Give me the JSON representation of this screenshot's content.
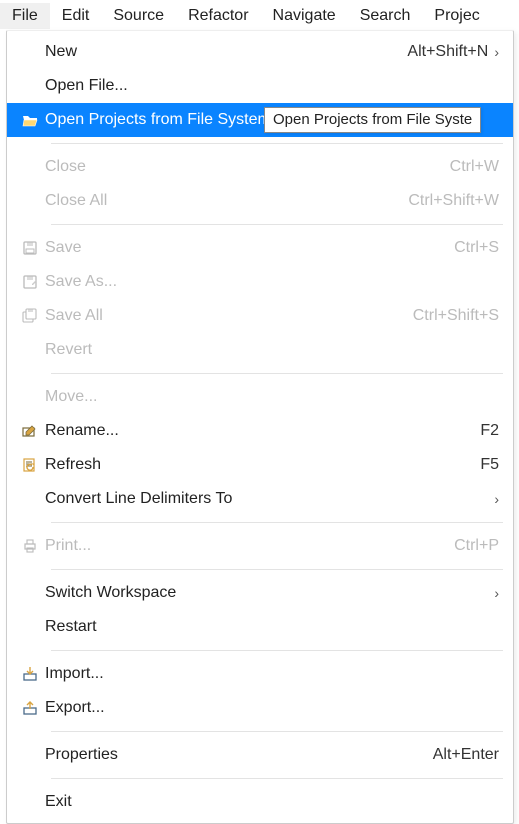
{
  "menubar": {
    "items": [
      {
        "label": "File",
        "active": true
      },
      {
        "label": "Edit"
      },
      {
        "label": "Source"
      },
      {
        "label": "Refactor"
      },
      {
        "label": "Navigate"
      },
      {
        "label": "Search"
      },
      {
        "label": "Projec"
      }
    ]
  },
  "dropdown": {
    "items": [
      {
        "label": "New",
        "accel": "Alt+Shift+N",
        "submenu": true,
        "disabled": false
      },
      {
        "label": "Open File...",
        "disabled": false
      },
      {
        "label": "Open Projects from File System...",
        "highlighted": true,
        "icon": "folder-open"
      },
      {
        "sep": true
      },
      {
        "label": "Close",
        "accel": "Ctrl+W",
        "disabled": true
      },
      {
        "label": "Close All",
        "accel": "Ctrl+Shift+W",
        "disabled": true
      },
      {
        "sep": true
      },
      {
        "label": "Save",
        "accel": "Ctrl+S",
        "icon": "save",
        "disabled": true
      },
      {
        "label": "Save As...",
        "icon": "save-as",
        "disabled": true
      },
      {
        "label": "Save All",
        "accel": "Ctrl+Shift+S",
        "icon": "save-all",
        "disabled": true
      },
      {
        "label": "Revert",
        "disabled": true
      },
      {
        "sep": true
      },
      {
        "label": "Move...",
        "disabled": true
      },
      {
        "label": "Rename...",
        "accel": "F2",
        "icon": "rename"
      },
      {
        "label": "Refresh",
        "accel": "F5",
        "icon": "refresh"
      },
      {
        "label": "Convert Line Delimiters To",
        "submenu": true
      },
      {
        "sep": true
      },
      {
        "label": "Print...",
        "accel": "Ctrl+P",
        "icon": "print",
        "disabled": true
      },
      {
        "sep": true
      },
      {
        "label": "Switch Workspace",
        "submenu": true
      },
      {
        "label": "Restart"
      },
      {
        "sep": true
      },
      {
        "label": "Import...",
        "icon": "import"
      },
      {
        "label": "Export...",
        "icon": "export"
      },
      {
        "sep": true
      },
      {
        "label": "Properties",
        "accel": "Alt+Enter"
      },
      {
        "sep": true
      },
      {
        "label": "Exit"
      }
    ]
  },
  "tooltip": {
    "text": "Open Projects from File Syste"
  },
  "colors": {
    "highlight": "#0a84ff"
  }
}
